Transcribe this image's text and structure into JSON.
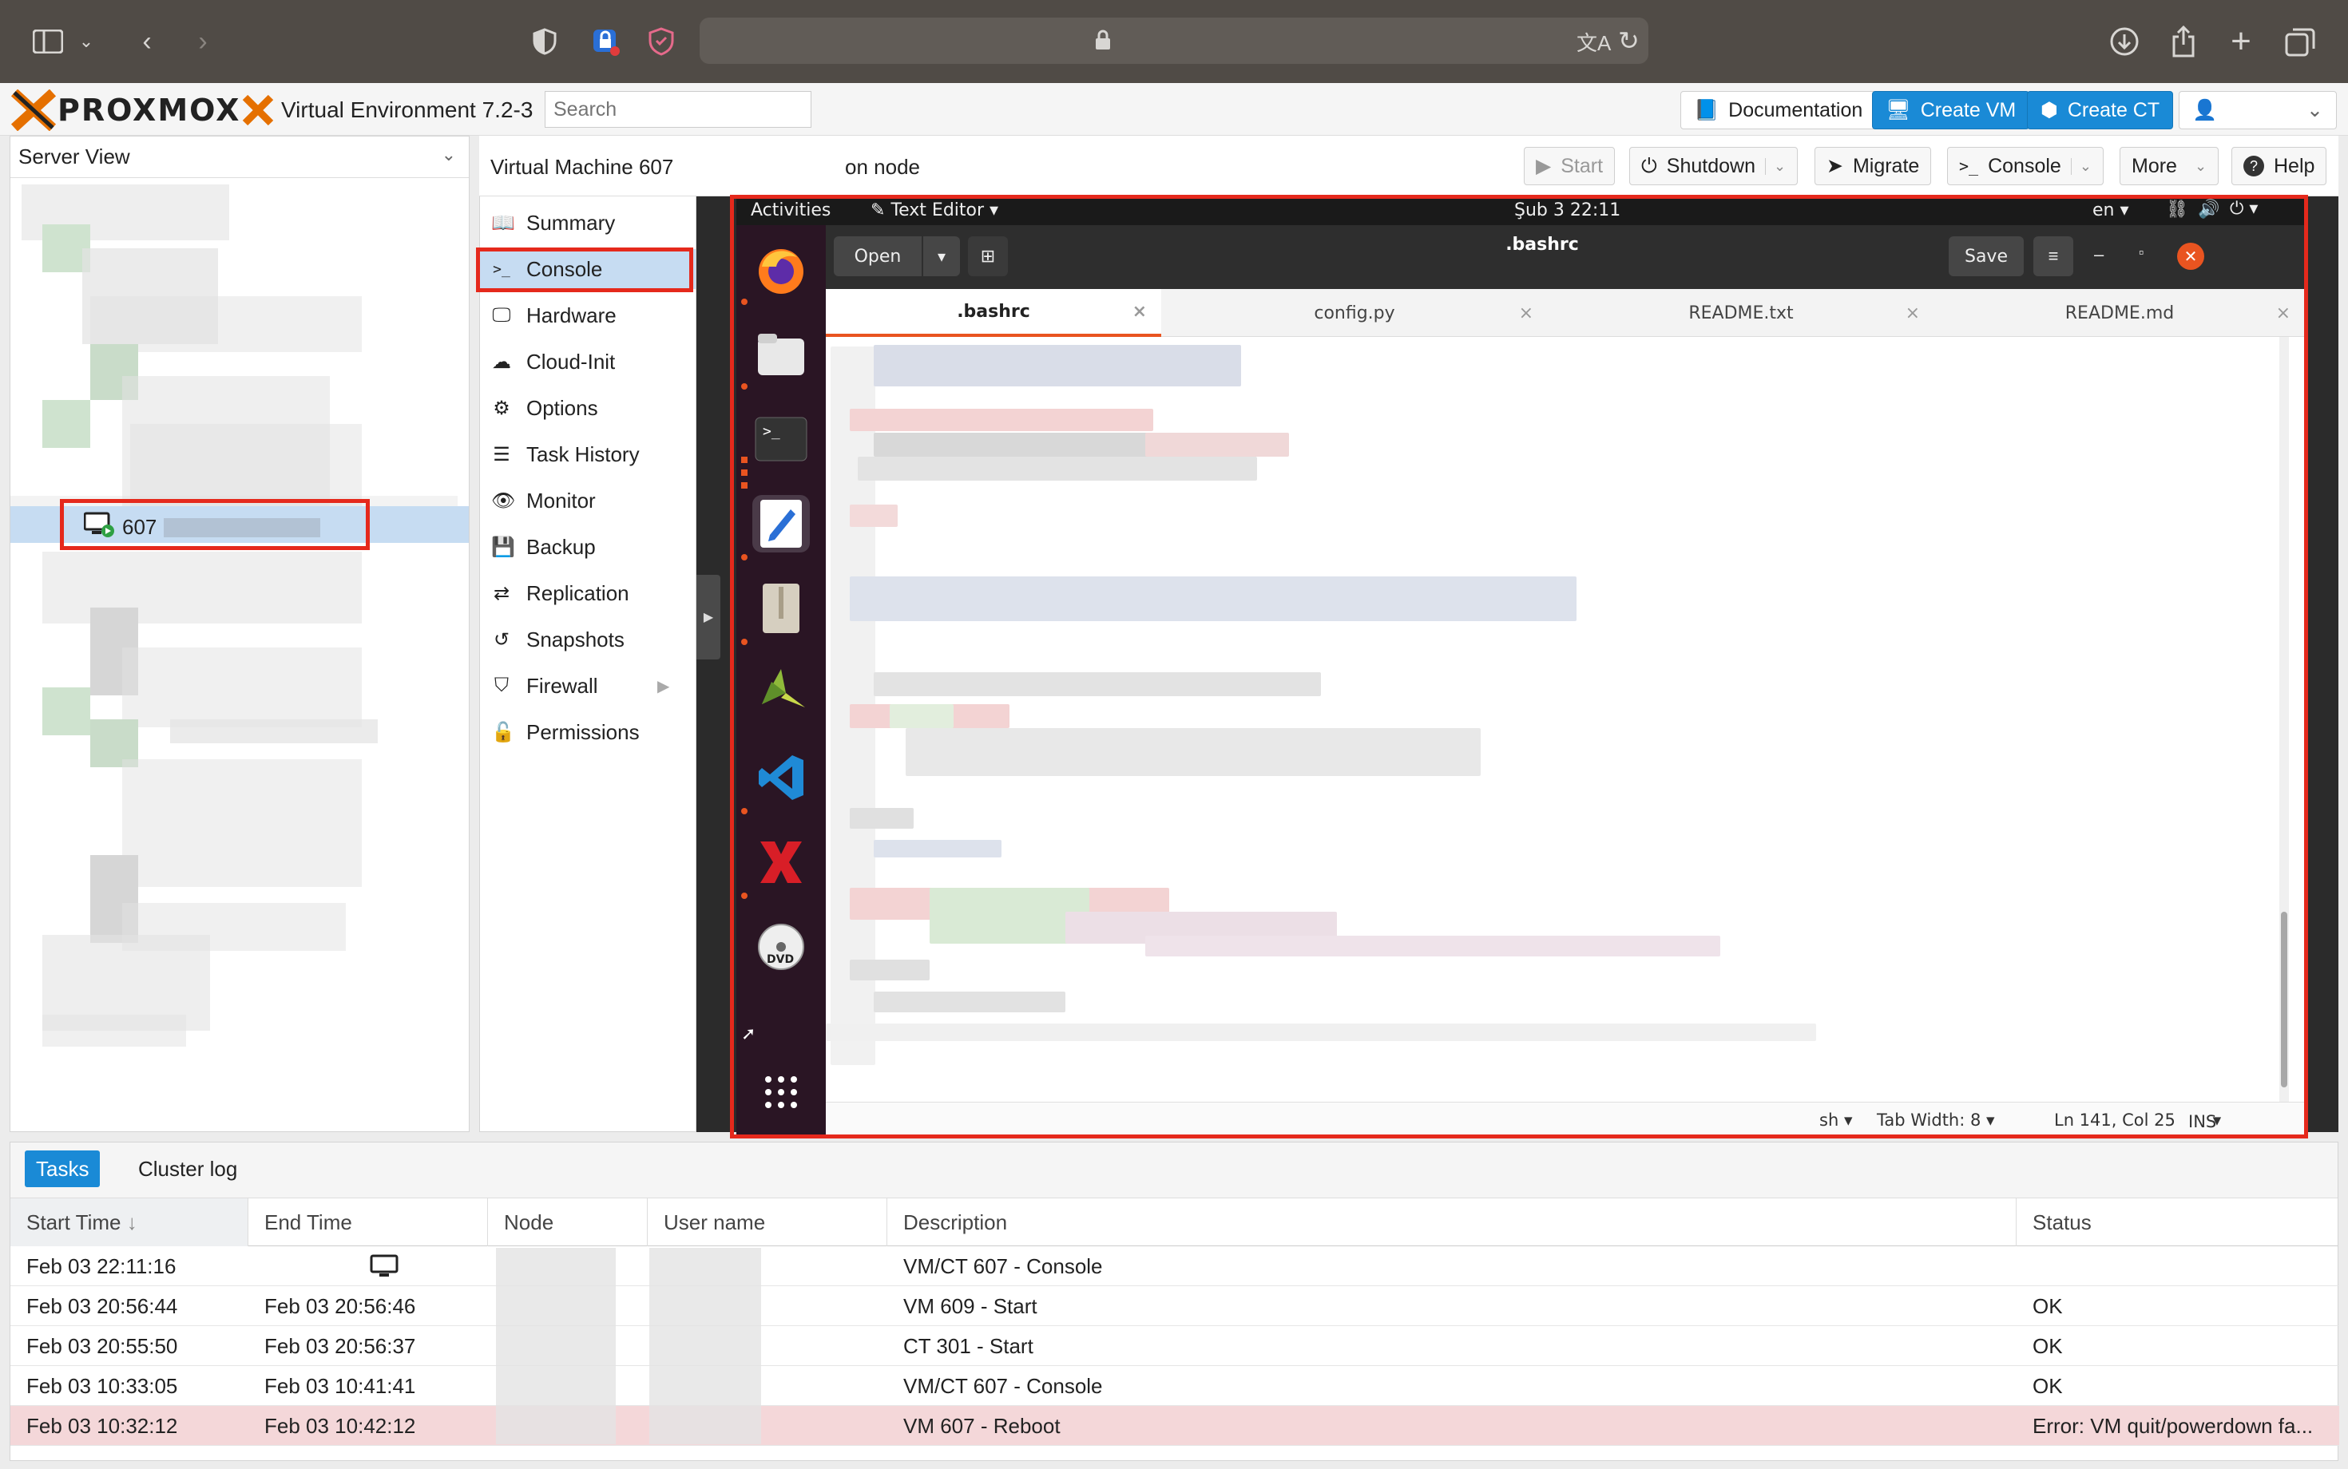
{
  "browser": {
    "icons": [
      "sidebar-icon",
      "chevron-down-icon",
      "back-icon",
      "forward-icon",
      "shield-icon",
      "lock-badge-icon",
      "privacy-shield-icon",
      "lock-icon",
      "translate-icon",
      "reload-icon",
      "download-icon",
      "share-icon",
      "new-tab-icon",
      "tabs-icon"
    ]
  },
  "header": {
    "logo": "PROXMOX",
    "product": "Virtual Environment 7.2-3",
    "search_placeholder": "Search",
    "documentation": "Documentation",
    "create_vm": "Create VM",
    "create_ct": "Create CT"
  },
  "sidebar": {
    "view": "Server View",
    "selected_vm": "607"
  },
  "toolbar": {
    "title": "Virtual Machine 607",
    "on_node": "on node",
    "start": "Start",
    "shutdown": "Shutdown",
    "migrate": "Migrate",
    "console": "Console",
    "more": "More",
    "help": "Help"
  },
  "menu": {
    "items": [
      {
        "label": "Summary",
        "icon": "book-icon"
      },
      {
        "label": "Console",
        "icon": "terminal-icon"
      },
      {
        "label": "Hardware",
        "icon": "desktop-icon"
      },
      {
        "label": "Cloud-Init",
        "icon": "cloud-icon"
      },
      {
        "label": "Options",
        "icon": "gear-icon"
      },
      {
        "label": "Task History",
        "icon": "list-icon"
      },
      {
        "label": "Monitor",
        "icon": "eye-icon"
      },
      {
        "label": "Backup",
        "icon": "floppy-icon"
      },
      {
        "label": "Replication",
        "icon": "retweet-icon"
      },
      {
        "label": "Snapshots",
        "icon": "history-icon"
      },
      {
        "label": "Firewall",
        "icon": "shield-icon"
      },
      {
        "label": "Permissions",
        "icon": "unlock-icon"
      }
    ]
  },
  "ubuntu": {
    "activities": "Activities",
    "app": "Text Editor",
    "clock": "Şub 3  22:11",
    "lang": "en",
    "open": "Open",
    "doc_title": ".bashrc",
    "save": "Save",
    "tabs": [
      ".bashrc",
      "config.py",
      "README.txt",
      "README.md"
    ],
    "status": {
      "lang": "sh",
      "tab_width": "Tab Width: 8",
      "position": "Ln 141, Col 25",
      "mode": "INS"
    }
  },
  "tasks": {
    "tabs": [
      "Tasks",
      "Cluster log"
    ],
    "columns": [
      "Start Time",
      "End Time",
      "Node",
      "User name",
      "Description",
      "Status"
    ],
    "rows": [
      {
        "start": "Feb 03 22:11:16",
        "end": "",
        "desc": "VM/CT 607 - Console",
        "status": ""
      },
      {
        "start": "Feb 03 20:56:44",
        "end": "Feb 03 20:56:46",
        "desc": "VM 609 - Start",
        "status": "OK"
      },
      {
        "start": "Feb 03 20:55:50",
        "end": "Feb 03 20:56:37",
        "desc": "CT 301 - Start",
        "status": "OK"
      },
      {
        "start": "Feb 03 10:33:05",
        "end": "Feb 03 10:41:41",
        "desc": "VM/CT 607 - Console",
        "status": "OK"
      },
      {
        "start": "Feb 03 10:32:12",
        "end": "Feb 03 10:42:12",
        "desc": "VM 607 - Reboot",
        "status": "Error: VM quit/powerdown fa..."
      }
    ]
  }
}
